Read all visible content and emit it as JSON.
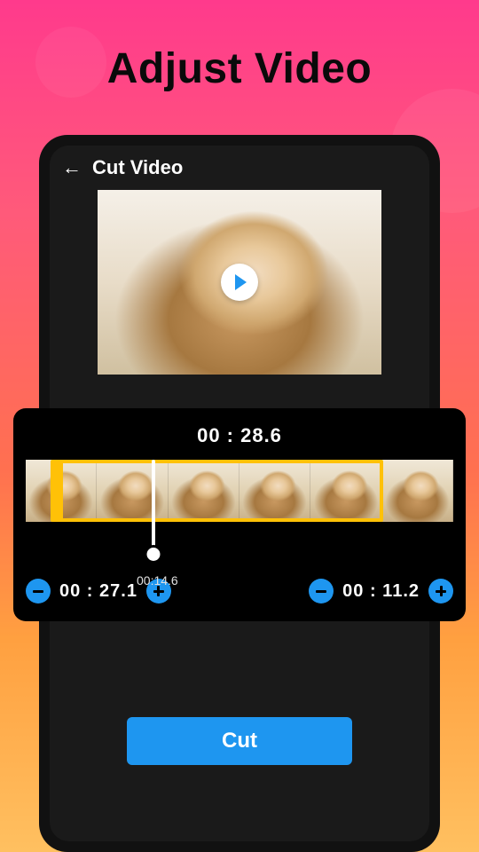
{
  "promo": {
    "title": "Adjust Video"
  },
  "header": {
    "title": "Cut Video"
  },
  "timeline": {
    "total_time": "00 : 28.6",
    "playhead_time": "00:14.6"
  },
  "start": {
    "value": "00 : 27.1"
  },
  "end": {
    "value": "00 : 11.2"
  },
  "actions": {
    "cut_label": "Cut"
  }
}
